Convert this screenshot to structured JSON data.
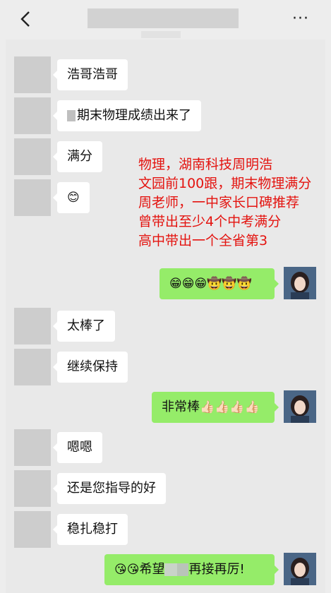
{
  "header": {
    "back_icon": "chevron-left-icon",
    "more_label": "···"
  },
  "messages": [
    {
      "side": "left",
      "text": "浩哥浩哥"
    },
    {
      "side": "left",
      "text": "期末物理成绩出来了"
    },
    {
      "side": "left",
      "text": "满分"
    },
    {
      "side": "left",
      "text": "😊"
    },
    {
      "side": "right",
      "text": "😁😁😁🤠🤠🤠"
    },
    {
      "side": "left",
      "text": "太棒了"
    },
    {
      "side": "left",
      "text": "继续保持"
    },
    {
      "side": "right",
      "text": "非常棒",
      "emoji": "👍🏻👍🏻👍🏻👍🏻"
    },
    {
      "side": "left",
      "text": "嗯嗯"
    },
    {
      "side": "left",
      "text": "还是您指导的好"
    },
    {
      "side": "left",
      "text": "稳扎稳打"
    },
    {
      "side": "right",
      "emoji": "😘😘",
      "text_a": "希望",
      "text_b": "再接再厉!"
    }
  ],
  "annotation": {
    "lines": [
      "物理，湖南科技周明浩",
      "文园前100跟，期末物理满分",
      "周老师，一中家长口碑推荐",
      "曾带出至少4个中考满分",
      "高中带出一个全省第3"
    ],
    "color": "#e4130f"
  },
  "colors": {
    "background": "#ededed",
    "bubble_in": "#ffffff",
    "bubble_out": "#95ec69"
  }
}
